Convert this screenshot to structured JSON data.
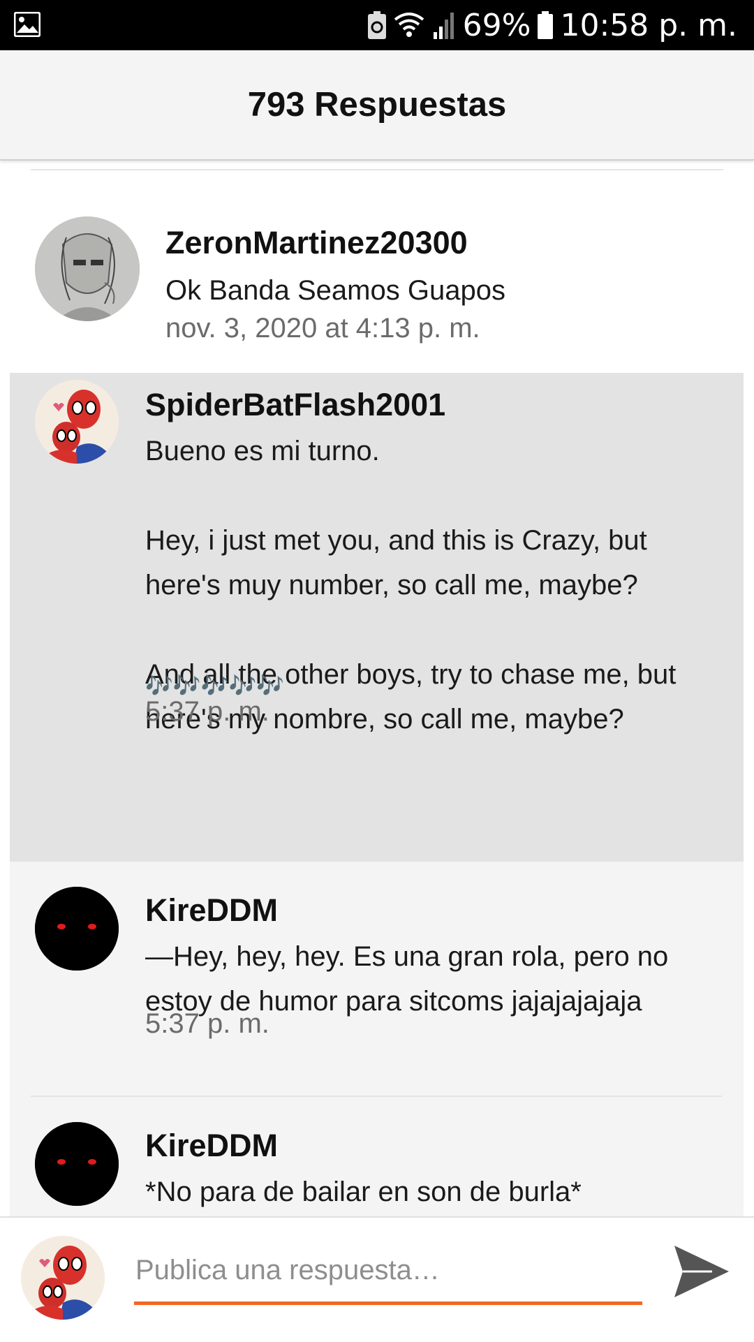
{
  "status_bar": {
    "battery": "69%",
    "time": "10:58 p. m."
  },
  "header": {
    "title": "793 Respuestas"
  },
  "comments": [
    {
      "username": "ZeronMartinez20300",
      "text": "Ok Banda Seamos Guapos",
      "timestamp": "nov. 3, 2020 at 4:13 p. m."
    },
    {
      "username": "SpiderBatFlash2001",
      "text": "Bueno es mi turno.\n\nHey, i just met you, and this is Crazy, but here's muy number, so call me, maybe?\n\nAnd all the other boys, try to chase me, but here's my nombre, so call me, maybe?",
      "emoji": "🎶🎶🎶🎶🎶",
      "timestamp": "5:37 p. m."
    },
    {
      "username": "KireDDM",
      "text": "—Hey, hey, hey. Es una gran rola, pero no estoy de humor para sitcoms jajajajajaja",
      "timestamp": "5:37 p. m."
    },
    {
      "username": "KireDDM",
      "text": "*No para de bailar en son de burla*"
    }
  ],
  "footer": {
    "placeholder": "Publica una respuesta…"
  },
  "colors": {
    "accent": "#f26722",
    "highlight_bg": "#e3e3e3",
    "reply_bg": "#f4f4f4"
  }
}
